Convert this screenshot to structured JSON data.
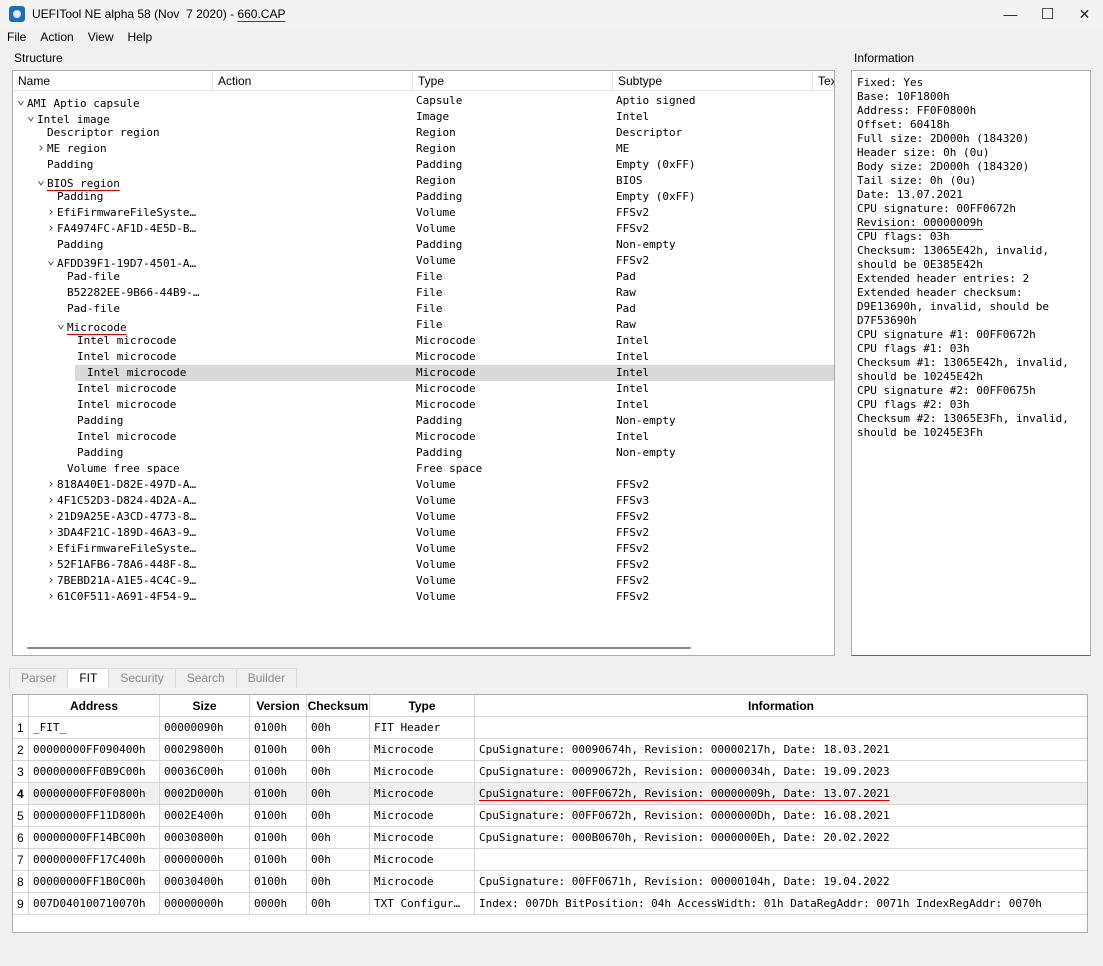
{
  "window": {
    "title_prefix": "UEFITool NE alpha 58 (Nov  7 2020) - ",
    "title_file": "660.CAP",
    "minimize": "—",
    "maximize": "☐",
    "close": "✕"
  },
  "menu": [
    "File",
    "Action",
    "View",
    "Help"
  ],
  "structure": {
    "label": "Structure",
    "headers": [
      "Name",
      "Action",
      "Type",
      "Subtype",
      "Tex"
    ],
    "rows": [
      {
        "name": "AMI Aptio capsule",
        "type": "Capsule",
        "sub": "Aptio signed",
        "depth": 0,
        "chev": "open"
      },
      {
        "name": "Intel image",
        "type": "Image",
        "sub": "Intel",
        "depth": 1,
        "chev": "open"
      },
      {
        "name": "Descriptor region",
        "type": "Region",
        "sub": "Descriptor",
        "depth": 2,
        "chev": "none"
      },
      {
        "name": "ME region",
        "type": "Region",
        "sub": "ME",
        "depth": 2,
        "chev": "closed"
      },
      {
        "name": "Padding",
        "type": "Padding",
        "sub": "Empty (0xFF)",
        "depth": 2,
        "chev": "none"
      },
      {
        "name": "BIOS region",
        "type": "Region",
        "sub": "BIOS",
        "depth": 2,
        "chev": "open",
        "mark": true
      },
      {
        "name": "Padding",
        "type": "Padding",
        "sub": "Empty (0xFF)",
        "depth": 3,
        "chev": "none"
      },
      {
        "name": "EfiFirmwareFileSyste…",
        "type": "Volume",
        "sub": "FFSv2",
        "depth": 3,
        "chev": "closed"
      },
      {
        "name": "FA4974FC-AF1D-4E5D-B…",
        "type": "Volume",
        "sub": "FFSv2",
        "depth": 3,
        "chev": "closed"
      },
      {
        "name": "Padding",
        "type": "Padding",
        "sub": "Non-empty",
        "depth": 3,
        "chev": "none"
      },
      {
        "name": "AFDD39F1-19D7-4501-A…",
        "type": "Volume",
        "sub": "FFSv2",
        "depth": 3,
        "chev": "open"
      },
      {
        "name": "Pad-file",
        "type": "File",
        "sub": "Pad",
        "depth": 4,
        "chev": "none"
      },
      {
        "name": "B52282EE-9B66-44B9-…",
        "type": "File",
        "sub": "Raw",
        "depth": 4,
        "chev": "none"
      },
      {
        "name": "Pad-file",
        "type": "File",
        "sub": "Pad",
        "depth": 4,
        "chev": "none"
      },
      {
        "name": "Microcode",
        "type": "File",
        "sub": "Raw",
        "depth": 4,
        "chev": "open",
        "mark": true
      },
      {
        "name": "Intel microcode",
        "type": "Microcode",
        "sub": "Intel",
        "depth": 5,
        "chev": "none"
      },
      {
        "name": "Intel microcode",
        "type": "Microcode",
        "sub": "Intel",
        "depth": 5,
        "chev": "none"
      },
      {
        "name": "Intel microcode",
        "type": "Microcode",
        "sub": "Intel",
        "depth": 5,
        "chev": "none",
        "selected": true
      },
      {
        "name": "Intel microcode",
        "type": "Microcode",
        "sub": "Intel",
        "depth": 5,
        "chev": "none"
      },
      {
        "name": "Intel microcode",
        "type": "Microcode",
        "sub": "Intel",
        "depth": 5,
        "chev": "none"
      },
      {
        "name": "Padding",
        "type": "Padding",
        "sub": "Non-empty",
        "depth": 5,
        "chev": "none"
      },
      {
        "name": "Intel microcode",
        "type": "Microcode",
        "sub": "Intel",
        "depth": 5,
        "chev": "none"
      },
      {
        "name": "Padding",
        "type": "Padding",
        "sub": "Non-empty",
        "depth": 5,
        "chev": "none"
      },
      {
        "name": "Volume free space",
        "type": "Free space",
        "sub": "",
        "depth": 4,
        "chev": "none"
      },
      {
        "name": "818A40E1-D82E-497D-A…",
        "type": "Volume",
        "sub": "FFSv2",
        "depth": 3,
        "chev": "closed"
      },
      {
        "name": "4F1C52D3-D824-4D2A-A…",
        "type": "Volume",
        "sub": "FFSv3",
        "depth": 3,
        "chev": "closed"
      },
      {
        "name": "21D9A25E-A3CD-4773-8…",
        "type": "Volume",
        "sub": "FFSv2",
        "depth": 3,
        "chev": "closed"
      },
      {
        "name": "3DA4F21C-189D-46A3-9…",
        "type": "Volume",
        "sub": "FFSv2",
        "depth": 3,
        "chev": "closed"
      },
      {
        "name": "EfiFirmwareFileSyste…",
        "type": "Volume",
        "sub": "FFSv2",
        "depth": 3,
        "chev": "closed"
      },
      {
        "name": "52F1AFB6-78A6-448F-8…",
        "type": "Volume",
        "sub": "FFSv2",
        "depth": 3,
        "chev": "closed"
      },
      {
        "name": "7BEBD21A-A1E5-4C4C-9…",
        "type": "Volume",
        "sub": "FFSv2",
        "depth": 3,
        "chev": "closed"
      },
      {
        "name": "61C0F511-A691-4F54-9…",
        "type": "Volume",
        "sub": "FFSv2",
        "depth": 3,
        "chev": "closed"
      }
    ]
  },
  "information": {
    "label": "Information",
    "lines": [
      "Fixed: Yes",
      "Base: 10F1800h",
      "Address: FF0F0800h",
      "Offset: 60418h",
      "Full size: 2D000h (184320)",
      "Header size: 0h (0u)",
      "Body size: 2D000h (184320)",
      "Tail size: 0h (0u)",
      "Date: 13.07.2021",
      "CPU signature: 00FF0672h",
      "Revision: 00000009h",
      "CPU flags: 03h",
      "Checksum: 13065E42h, invalid,",
      "should be 0E385E42h",
      "Extended header entries: 2",
      "Extended header checksum:",
      "D9E13690h, invalid, should be",
      "D7F53690h",
      "CPU signature #1: 00FF0672h",
      "CPU flags #1: 03h",
      "Checksum #1: 13065E42h, invalid,",
      "should be 10245E42h",
      "CPU signature #2: 00FF0675h",
      "CPU flags #2: 03h",
      "Checksum #2: 13065E3Fh, invalid,",
      "should be 10245E3Fh"
    ]
  },
  "tabs": [
    "Parser",
    "FIT",
    "Security",
    "Search",
    "Builder"
  ],
  "fit": {
    "headers": [
      "Address",
      "Size",
      "Version",
      "Checksum",
      "Type",
      "Information"
    ],
    "rows": [
      {
        "n": "1",
        "address": "_FIT_",
        "size": "00000090h",
        "version": "0100h",
        "checksum": "00h",
        "type": "FIT Header",
        "info": ""
      },
      {
        "n": "2",
        "address": "00000000FF090400h",
        "size": "00029800h",
        "version": "0100h",
        "checksum": "00h",
        "type": "Microcode",
        "info": "CpuSignature: 00090674h, Revision: 00000217h, Date: 18.03.2021"
      },
      {
        "n": "3",
        "address": "00000000FF0B9C00h",
        "size": "00036C00h",
        "version": "0100h",
        "checksum": "00h",
        "type": "Microcode",
        "info": "CpuSignature: 00090672h, Revision: 00000034h, Date: 19.09.2023"
      },
      {
        "n": "4",
        "address": "00000000FF0F0800h",
        "size": "0002D000h",
        "version": "0100h",
        "checksum": "00h",
        "type": "Microcode",
        "info": "CpuSignature: 00FF0672h, Revision: 00000009h, Date: 13.07.2021",
        "selected": true
      },
      {
        "n": "5",
        "address": "00000000FF11D800h",
        "size": "0002E400h",
        "version": "0100h",
        "checksum": "00h",
        "type": "Microcode",
        "info": "CpuSignature: 00FF0672h, Revision: 0000000Dh, Date: 16.08.2021"
      },
      {
        "n": "6",
        "address": "00000000FF14BC00h",
        "size": "00030800h",
        "version": "0100h",
        "checksum": "00h",
        "type": "Microcode",
        "info": "CpuSignature: 000B0670h, Revision: 0000000Eh, Date: 20.02.2022"
      },
      {
        "n": "7",
        "address": "00000000FF17C400h",
        "size": "00000000h",
        "version": "0100h",
        "checksum": "00h",
        "type": "Microcode",
        "info": ""
      },
      {
        "n": "8",
        "address": "00000000FF1B0C00h",
        "size": "00030400h",
        "version": "0100h",
        "checksum": "00h",
        "type": "Microcode",
        "info": "CpuSignature: 00FF0671h, Revision: 00000104h, Date: 19.04.2022"
      },
      {
        "n": "9",
        "address": "007D040100710070h",
        "size": "00000000h",
        "version": "0000h",
        "checksum": "00h",
        "type": "TXT Configur…",
        "info": "Index: 007Dh BitPosition: 04h AccessWidth: 01h DataRegAddr: 0071h IndexRegAddr: 0070h"
      }
    ]
  }
}
